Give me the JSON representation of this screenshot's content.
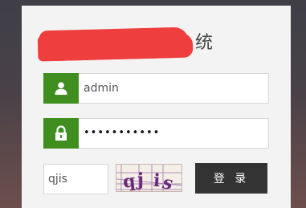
{
  "form": {
    "title_visible_suffix": "统",
    "username": {
      "value": "admin",
      "icon": "user-icon"
    },
    "password": {
      "masked_value": "•••••••••••",
      "icon": "lock-icon"
    },
    "captcha": {
      "input_value": "qjis",
      "image_text": "qjis"
    },
    "login_label": "登 录"
  },
  "colors": {
    "icon_bg": "#3f8e1f",
    "button_bg": "#333333",
    "redaction": "#ef3e3e"
  }
}
